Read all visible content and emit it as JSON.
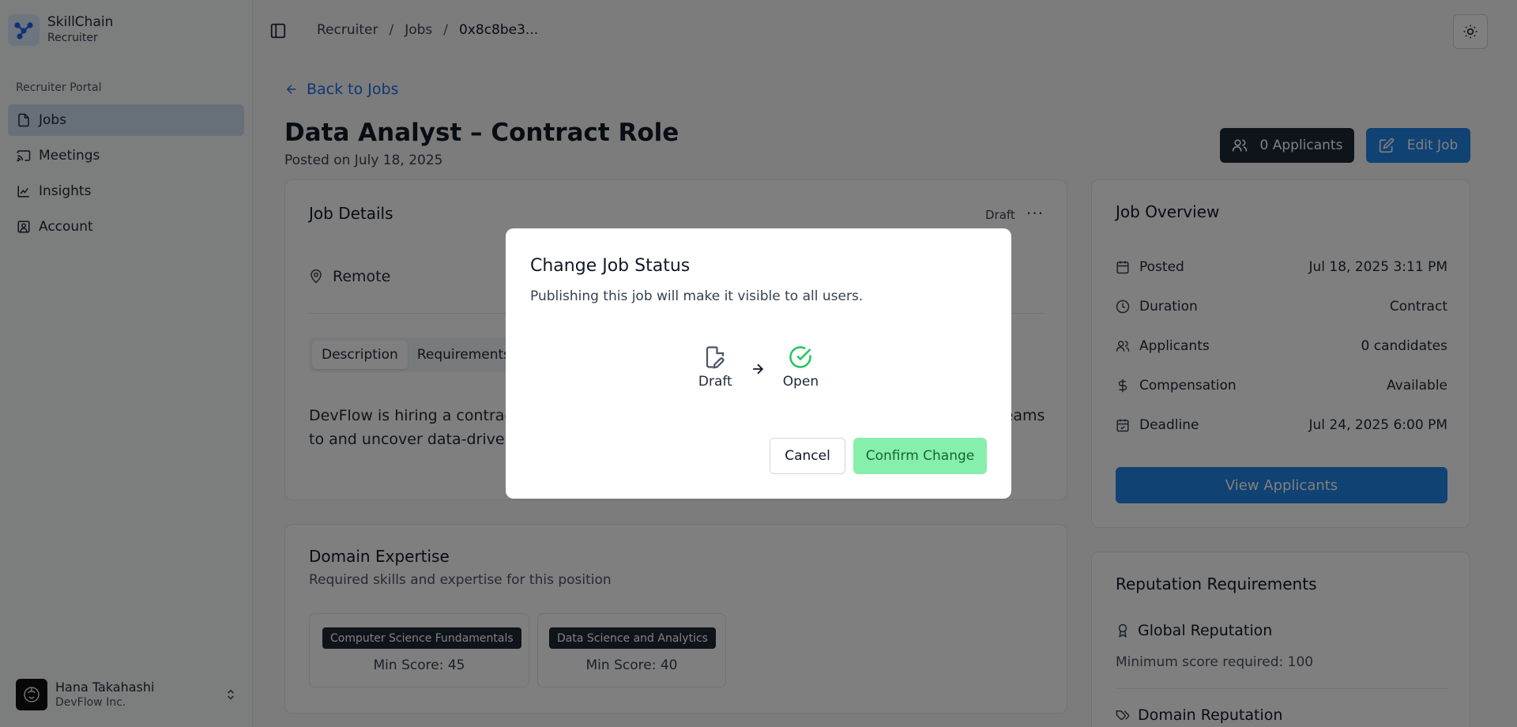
{
  "brand": {
    "name": "SkillChain",
    "subtitle": "Recruiter"
  },
  "sidebar": {
    "section_label": "Recruiter Portal",
    "items": [
      {
        "label": "Jobs",
        "icon": "file-icon",
        "active": true
      },
      {
        "label": "Meetings",
        "icon": "cast-icon",
        "active": false
      },
      {
        "label": "Insights",
        "icon": "chart-icon",
        "active": false
      },
      {
        "label": "Account",
        "icon": "user-square-icon",
        "active": false
      }
    ],
    "user": {
      "name": "Hana Takahashi",
      "org": "DevFlow Inc."
    }
  },
  "header": {
    "breadcrumbs": [
      "Recruiter",
      "Jobs",
      "0x8c8be3..."
    ]
  },
  "main": {
    "back_label": "Back to Jobs",
    "title": "Data Analyst – Contract Role",
    "posted": "Posted on July 18, 2025",
    "applicants_button": "0 Applicants",
    "edit_button": "Edit Job",
    "details": {
      "title": "Job Details",
      "status": "Draft",
      "location": "Remote",
      "tabs": [
        "Description",
        "Requirements"
      ],
      "description": "DevFlow is hiring a contract Data Analyst to work closely with the product and engineering teams to and uncover data-driven insights."
    },
    "domain": {
      "title": "Domain Expertise",
      "subtitle": "Required skills and expertise for this position",
      "skills": [
        {
          "name": "Computer Science Fundamentals",
          "score": "Min Score: 45"
        },
        {
          "name": "Data Science and Analytics",
          "score": "Min Score: 40"
        }
      ]
    },
    "overview": {
      "title": "Job Overview",
      "rows": [
        {
          "label": "Posted",
          "value": "Jul 18, 2025 3:11 PM",
          "icon": "calendar-icon"
        },
        {
          "label": "Duration",
          "value": "Contract",
          "icon": "clock-icon"
        },
        {
          "label": "Applicants",
          "value": "0 candidates",
          "icon": "users-icon"
        },
        {
          "label": "Compensation",
          "value": "Available",
          "icon": "dollar-icon"
        },
        {
          "label": "Deadline",
          "value": "Jul 24, 2025 6:00 PM",
          "icon": "calendar-check-icon"
        }
      ],
      "view_button": "View Applicants"
    },
    "reputation": {
      "title": "Reputation Requirements",
      "global_label": "Global Reputation",
      "global_min": "Minimum score required: 100",
      "domain_label": "Domain Reputation"
    }
  },
  "modal": {
    "title": "Change Job Status",
    "description": "Publishing this job will make it visible to all users.",
    "from": "Draft",
    "to": "Open",
    "cancel": "Cancel",
    "confirm": "Confirm Change"
  },
  "colors": {
    "primary": "#2185e6",
    "dark": "#1f2937",
    "confirm_bg": "#86efac",
    "confirm_text": "#166534",
    "success_icon": "#22c55e"
  }
}
